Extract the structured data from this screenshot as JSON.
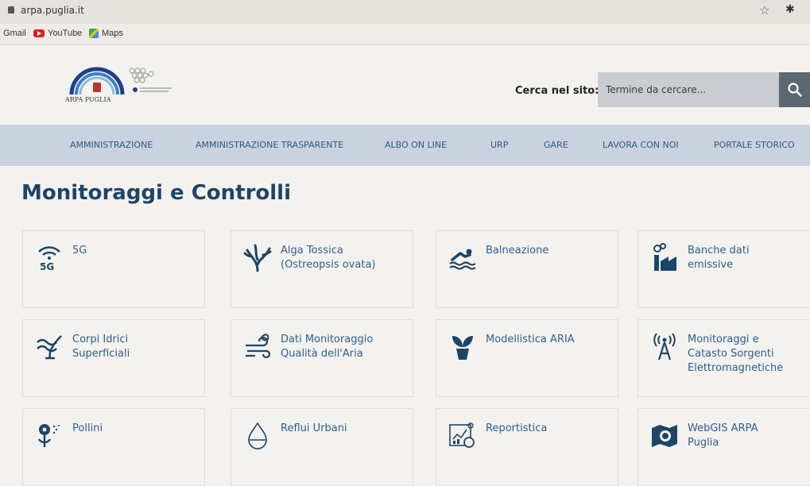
{
  "browser": {
    "url": "arpa.puglia.it",
    "bookmarks": [
      "Gmail",
      "YouTube",
      "Maps"
    ]
  },
  "header": {
    "logo_text": "ARPA PUGLIA",
    "search_label": "Cerca nel sito:",
    "search_placeholder": "Termine da cercare..."
  },
  "nav": {
    "items": [
      "AMMINISTRAZIONE",
      "AMMINISTRAZIONE TRASPARENTE",
      "ALBO ON LINE",
      "URP",
      "GARE",
      "LAVORA CON NOI",
      "PORTALE STORICO"
    ]
  },
  "main": {
    "title": "Monitoraggi e Controlli",
    "tiles": [
      {
        "label": "5G",
        "icon": "wifi-5g-icon"
      },
      {
        "label": "Alga Tossica\n(Ostreopsis ovata)",
        "icon": "seaweed-icon"
      },
      {
        "label": "Balneazione",
        "icon": "swimmer-icon"
      },
      {
        "label": "Banche dati\nemissive",
        "icon": "factory-icon"
      },
      {
        "label": "Corpi Idrici\nSuperficiali",
        "icon": "water-bodies-icon"
      },
      {
        "label": "Dati Monitoraggio\nQualità dell'Aria",
        "icon": "air-quality-icon"
      },
      {
        "label": "Modellistica ARIA",
        "icon": "leaves-pot-icon"
      },
      {
        "label": "Monitoraggi e\nCatasto Sorgenti\nElettromagnetiche",
        "icon": "antenna-icon"
      },
      {
        "label": "Pollini",
        "icon": "flower-icon"
      },
      {
        "label": "Reflui Urbani",
        "icon": "drop-icon"
      },
      {
        "label": "Reportistica",
        "icon": "report-icon"
      },
      {
        "label": "WebGIS ARPA\nPuglia",
        "icon": "map-icon"
      }
    ]
  },
  "colors": {
    "accent": "#2b5f8f",
    "nav_bg": "#c9d2de",
    "title": "#1d4568"
  }
}
